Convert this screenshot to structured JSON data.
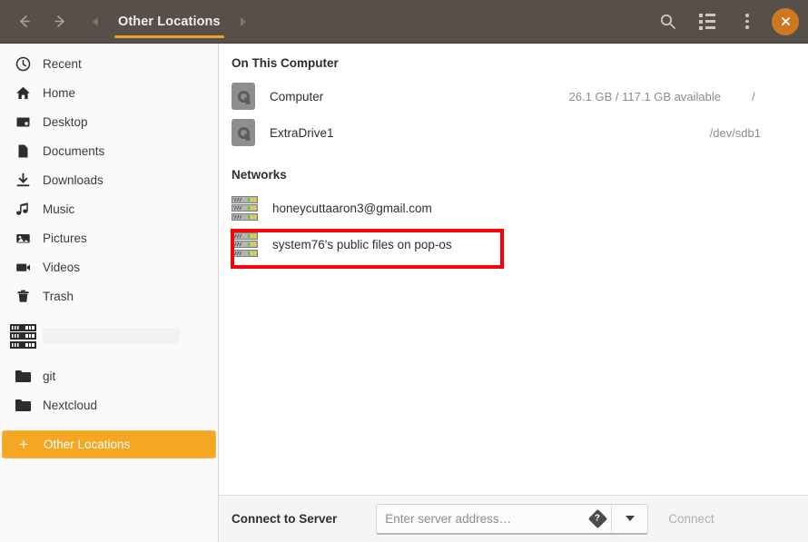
{
  "header": {
    "back_icon": "arrow-left-icon",
    "forward_icon": "arrow-right-icon",
    "tab_prev_icon": "chevron-left-icon",
    "tab_next_icon": "chevron-right-icon",
    "tab_label": "Other Locations",
    "search_icon": "search-icon",
    "view_list_icon": "list-view-icon",
    "menu_icon": "kebab-menu-icon",
    "close_icon": "close-icon",
    "accent_color": "#f0a22e",
    "background_color": "#574f4a",
    "close_button_color": "#cd7722"
  },
  "sidebar": {
    "items": [
      {
        "label": "Recent",
        "icon": "clock-icon"
      },
      {
        "label": "Home",
        "icon": "home-icon"
      },
      {
        "label": "Desktop",
        "icon": "desktop-icon"
      },
      {
        "label": "Documents",
        "icon": "document-icon"
      },
      {
        "label": "Downloads",
        "icon": "download-icon"
      },
      {
        "label": "Music",
        "icon": "music-note-icon"
      },
      {
        "label": "Pictures",
        "icon": "image-icon"
      },
      {
        "label": "Videos",
        "icon": "video-camera-icon"
      },
      {
        "label": "Trash",
        "icon": "trash-icon"
      }
    ],
    "network_mount": {
      "label": "",
      "icon": "server-icon"
    },
    "bookmarks": [
      {
        "label": "git",
        "icon": "folder-icon"
      },
      {
        "label": "Nextcloud",
        "icon": "folder-icon"
      }
    ],
    "other_locations": {
      "label": "Other Locations",
      "icon": "plus-icon",
      "selected": true,
      "selected_color": "#f5a623"
    }
  },
  "main": {
    "sections": [
      {
        "title": "On This Computer",
        "rows": [
          {
            "name": "Computer",
            "icon": "hard-drive-icon",
            "capacity": "26.1 GB / 117.1 GB available",
            "mount": "/"
          },
          {
            "name": "ExtraDrive1",
            "icon": "hard-drive-icon",
            "capacity": "",
            "mount": "/dev/sdb1"
          }
        ]
      },
      {
        "title": "Networks",
        "rows": [
          {
            "name": "honeycuttaaron3@gmail.com",
            "icon": "network-server-icon",
            "capacity": "",
            "mount": ""
          },
          {
            "name": "system76's public files on pop-os",
            "icon": "network-server-icon",
            "capacity": "",
            "mount": "",
            "highlighted": true
          }
        ]
      }
    ]
  },
  "footer": {
    "label": "Connect to Server",
    "address_value": "",
    "address_placeholder": "Enter server address…",
    "help_icon": "help-icon",
    "dropdown_icon": "chevron-down-icon",
    "connect_label": "Connect"
  },
  "annotation": {
    "color": "#fb0007",
    "target": "system76's public files on pop-os"
  }
}
